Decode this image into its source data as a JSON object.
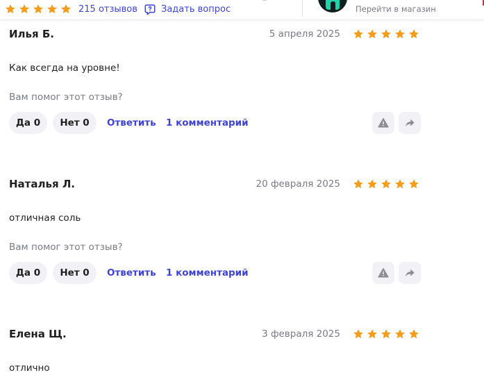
{
  "header": {
    "rating_stars": 5,
    "reviews_link": "215 отзывов",
    "ask_question": "Задать вопрос",
    "store_link": "Перейти в магазин",
    "star_color": "#f59c1a",
    "link_color": "#3f44d6"
  },
  "reviews": [
    {
      "author": "Илья Б.",
      "date": "5 апреля 2025",
      "rating": 5,
      "text": "Как всегда на уровне!",
      "helpful_prompt": "Вам помог этот отзыв?",
      "yes_label": "Да 0",
      "no_label": "Нет 0",
      "reply_label": "Ответить",
      "comments_label": "1 комментарий"
    },
    {
      "author": "Наталья Л.",
      "date": "20 февраля 2025",
      "rating": 5,
      "text": "отличная соль",
      "helpful_prompt": "Вам помог этот отзыв?",
      "yes_label": "Да 0",
      "no_label": "Нет 0",
      "reply_label": "Ответить",
      "comments_label": "1 комментарий"
    },
    {
      "author": "Елена Щ.",
      "date": "3 февраля 2025",
      "rating": 5,
      "text": "отлично"
    }
  ],
  "icons": {
    "star": "star-icon",
    "ask": "chat-question-icon",
    "report": "warning-icon",
    "share": "share-arrow-icon"
  }
}
